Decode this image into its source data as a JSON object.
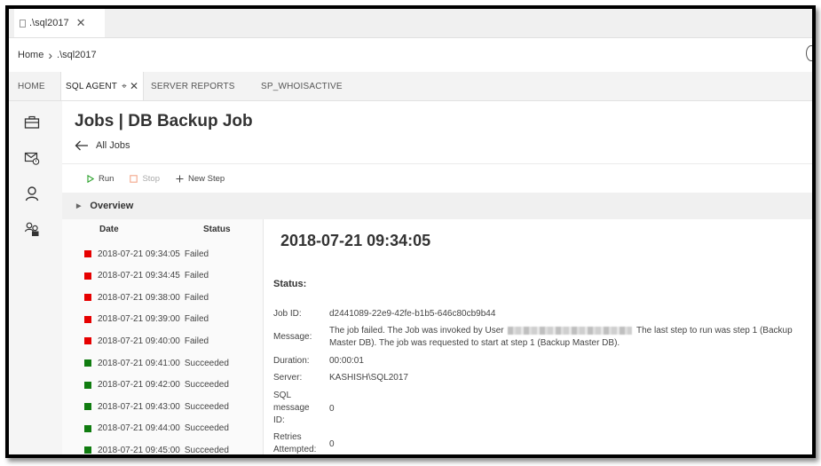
{
  "document_tab": {
    "title": ".\\sql2017",
    "close": "✕"
  },
  "breadcrumb": {
    "home": "Home",
    "current": ".\\sql2017"
  },
  "tabs": [
    {
      "label": "HOME"
    },
    {
      "label": "SQL AGENT",
      "pin": "⌖",
      "close": "✕"
    },
    {
      "label": "SERVER REPORTS"
    },
    {
      "label": "SP_WHOISACTIVE"
    }
  ],
  "sidebar": {
    "icons": [
      "jobs-briefcase-icon",
      "alerts-mail-icon",
      "operators-person-icon",
      "proxies-people-icon"
    ]
  },
  "page": {
    "title": "Jobs | DB Backup Job",
    "back_label": "All Jobs"
  },
  "toolbar": {
    "run": "Run",
    "stop": "Stop",
    "new_step": "New Step"
  },
  "overview": {
    "label": "Overview"
  },
  "history": {
    "col_date": "Date",
    "col_status": "Status",
    "runs": [
      {
        "date": "2018-07-21 09:34:05",
        "status": "Failed"
      },
      {
        "date": "2018-07-21 09:34:45",
        "status": "Failed"
      },
      {
        "date": "2018-07-21 09:38:00",
        "status": "Failed"
      },
      {
        "date": "2018-07-21 09:39:00",
        "status": "Failed"
      },
      {
        "date": "2018-07-21 09:40:00",
        "status": "Failed"
      },
      {
        "date": "2018-07-21 09:41:00",
        "status": "Succeeded"
      },
      {
        "date": "2018-07-21 09:42:00",
        "status": "Succeeded"
      },
      {
        "date": "2018-07-21 09:43:00",
        "status": "Succeeded"
      },
      {
        "date": "2018-07-21 09:44:00",
        "status": "Succeeded"
      },
      {
        "date": "2018-07-21 09:45:00",
        "status": "Succeeded"
      }
    ]
  },
  "detail": {
    "title": "2018-07-21 09:34:05",
    "status_label": "Status:",
    "job_id_label": "Job ID:",
    "job_id": "d2441089-22e9-42fe-b1b5-646c80cb9b44",
    "message_label": "Message:",
    "message_prefix": "The job failed. The Job was invoked by User",
    "message_suffix": "The last step to run was step 1 (Backup Master DB). The job was requested to start at step 1 (Backup Master DB).",
    "duration_label": "Duration:",
    "duration": "00:00:01",
    "server_label": "Server:",
    "server": "KASHISH\\SQL2017",
    "sql_msg_label": "SQL message ID:",
    "sql_msg": "0",
    "retries_label": "Retries Attempted:",
    "retries": "0"
  },
  "colors": {
    "failed": "#e60000",
    "succeeded": "#107c10",
    "run_icon": "#2aa12a",
    "stop_icon": "#f4a58a"
  }
}
